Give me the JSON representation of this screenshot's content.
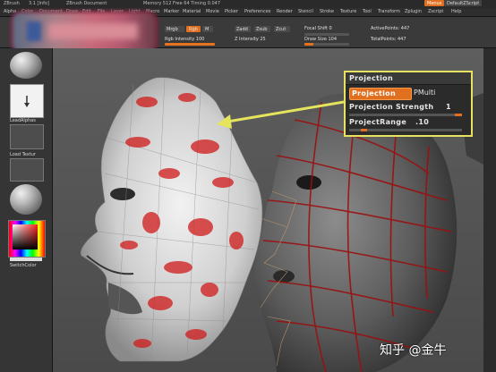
{
  "titlebar": {
    "app": "ZBrush",
    "version": "3.1 [Info]",
    "document": "ZBrush Document",
    "stats": "Memory 512  Free 64  Timing 0.047",
    "right_button": "Menus",
    "right_script": "DefaultZScript"
  },
  "menu": [
    "Alpha",
    "Color",
    "Document",
    "Draw",
    "Edit",
    "File",
    "Layer",
    "Light",
    "Macro",
    "Marker",
    "Material",
    "Movie",
    "Picker",
    "Preferences",
    "Render",
    "Stencil",
    "Stroke",
    "Texture",
    "Tool",
    "Transform",
    "Zplugin",
    "Zscript",
    "Help"
  ],
  "shelf": {
    "mrgb": "Mrgb",
    "rgb": "Rgb",
    "m": "M",
    "zadd": "Zadd",
    "zsub": "Zsub",
    "zcut": "Zcut",
    "rgb_intensity_label": "Rgb Intensity 100",
    "z_intensity_label": "Z Intensity 25",
    "focal_shift": "Focal Shift 0",
    "draw_size": "Draw Size 104",
    "active_points": "ActivePoints: 447",
    "total_points": "TotalPoints: 447",
    "rgb_intensity": 100,
    "draw_size_value": 104
  },
  "leftpanel": {
    "label_alpha": "LeadAlphas",
    "label_texture": "Load Textur",
    "label_switch": "SwitchColor"
  },
  "projection": {
    "title": "Projection",
    "button": "Projection",
    "pmulti": "PMulti",
    "strength_label": "Projection Strength",
    "strength_value": "1",
    "range_label": "ProjectRange",
    "range_value": ".10",
    "strength": 1,
    "range": 0.1
  },
  "watermark": "知乎 @金牛",
  "colors": {
    "accent": "#e07020",
    "highlight_box": "#e6e35c",
    "viewport_bg": "#545454"
  }
}
